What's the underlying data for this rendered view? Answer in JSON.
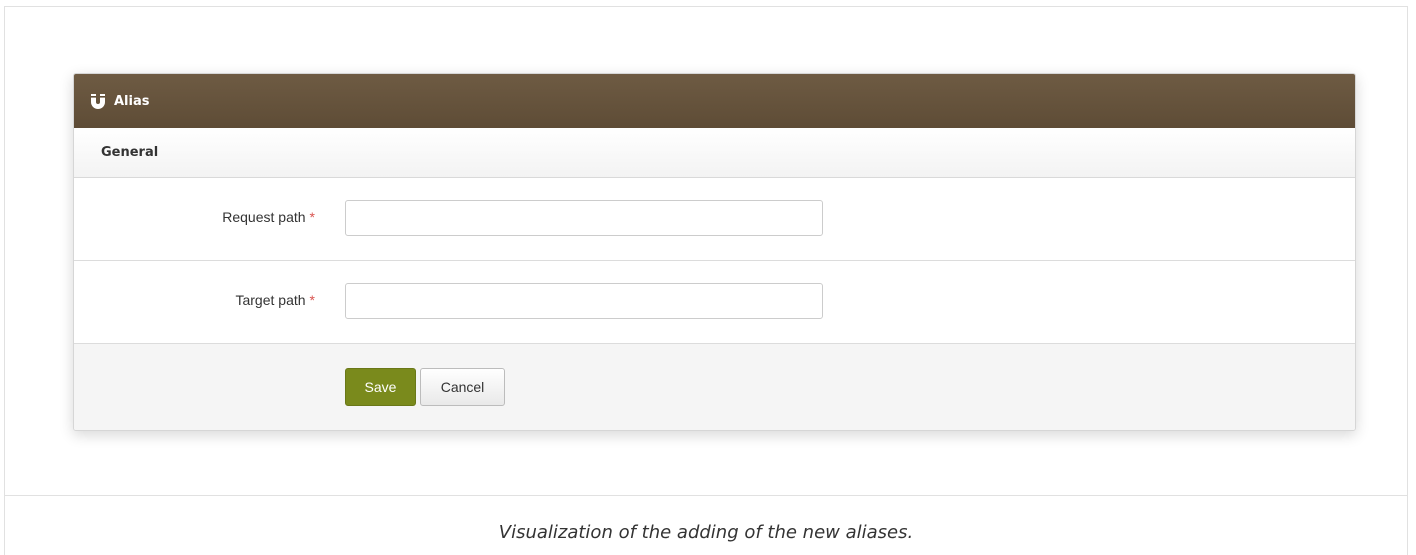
{
  "panel": {
    "title": "Alias",
    "icon": "magnet-icon",
    "header_color": "#5e4c36"
  },
  "section": {
    "title": "General"
  },
  "form": {
    "request_path": {
      "label": "Request path",
      "required_mark": "*",
      "value": ""
    },
    "target_path": {
      "label": "Target path",
      "required_mark": "*",
      "value": ""
    }
  },
  "actions": {
    "save_label": "Save",
    "cancel_label": "Cancel",
    "save_color": "#7a8a1c"
  },
  "caption": "Visualization of the adding of the new aliases."
}
